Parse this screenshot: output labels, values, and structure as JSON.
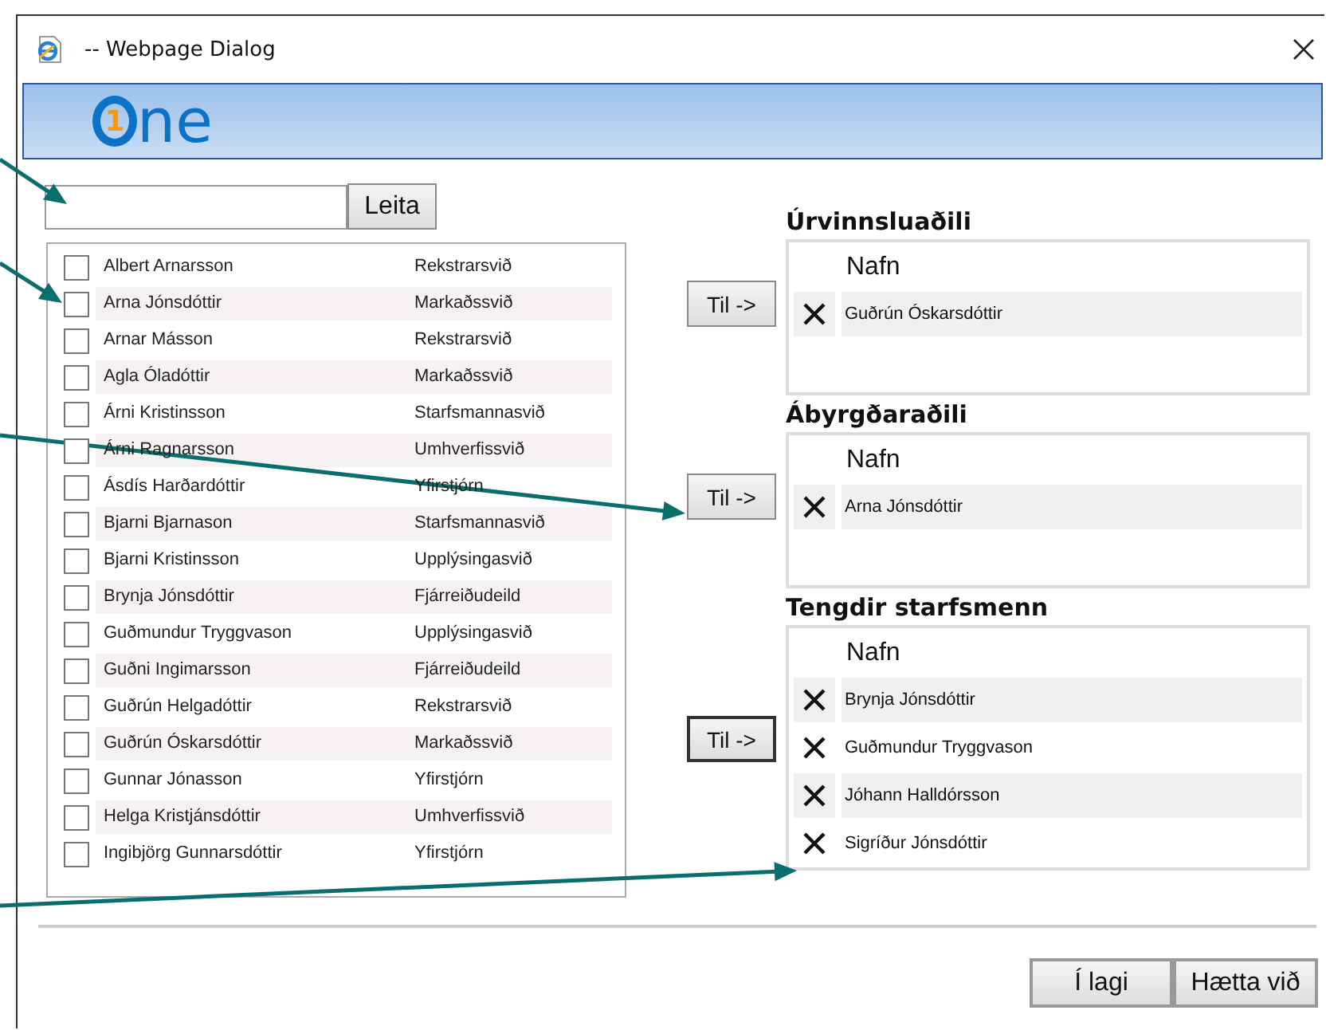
{
  "window": {
    "title": "-- Webpage Dialog"
  },
  "logo": {
    "badge": "1",
    "text": "ne"
  },
  "search": {
    "button": "Leita"
  },
  "people": [
    {
      "name": "Albert Arnarsson",
      "department": "Rekstrarsvið",
      "checked": false
    },
    {
      "name": "Arna Jónsdóttir",
      "department": "Markaðssvið",
      "checked": false
    },
    {
      "name": "Arnar Másson",
      "department": "Rekstrarsvið",
      "checked": false
    },
    {
      "name": "Agla Óladóttir",
      "department": "Markaðssvið",
      "checked": false
    },
    {
      "name": "Árni Kristinsson",
      "department": "Starfsmannasvið",
      "checked": false
    },
    {
      "name": "Árni Ragnarsson",
      "department": "Umhverfissvið",
      "checked": false
    },
    {
      "name": "Ásdís Harðardóttir",
      "department": "Yfirstjórn",
      "checked": false
    },
    {
      "name": "Bjarni Bjarnason",
      "department": "Starfsmannasvið",
      "checked": false
    },
    {
      "name": "Bjarni Kristinsson",
      "department": "Upplýsingasvið",
      "checked": false
    },
    {
      "name": "Brynja Jónsdóttir",
      "department": "Fjárreiðudeild",
      "checked": false
    },
    {
      "name": "Guðmundur Tryggvason",
      "department": "Upplýsingasvið",
      "checked": false
    },
    {
      "name": "Guðni Ingimarsson",
      "department": "Fjárreiðudeild",
      "checked": false
    },
    {
      "name": "Guðrún Helgadóttir",
      "department": "Rekstrarsvið",
      "checked": false
    },
    {
      "name": "Guðrún Óskarsdóttir",
      "department": "Markaðssvið",
      "checked": false
    },
    {
      "name": "Gunnar Jónasson",
      "department": "Yfirstjórn",
      "checked": false
    },
    {
      "name": "Helga Kristjánsdóttir",
      "department": "Umhverfissvið",
      "checked": false
    },
    {
      "name": "Ingibjörg Gunnarsdóttir",
      "department": "Yfirstjórn",
      "checked": false
    }
  ],
  "groups": [
    {
      "title": "Úrvinnsluaðili",
      "button": {
        "label": "Til ->",
        "focused": false
      },
      "column": "Nafn",
      "members": [
        "Guðrún Óskarsdóttir"
      ]
    },
    {
      "title": "Ábyrgðaraðili",
      "button": {
        "label": "Til ->",
        "focused": false
      },
      "column": "Nafn",
      "members": [
        "Arna Jónsdóttir"
      ]
    },
    {
      "title": "Tengdir starfsmenn",
      "button": {
        "label": "Til ->",
        "focused": true
      },
      "column": "Nafn",
      "members": [
        "Brynja Jónsdóttir",
        "Guðmundur Tryggvason",
        "Jóhann Halldórsson",
        "Sigríður Jónsdóttir"
      ]
    }
  ],
  "buttons": [
    "Í lagi",
    "Hætta við"
  ]
}
